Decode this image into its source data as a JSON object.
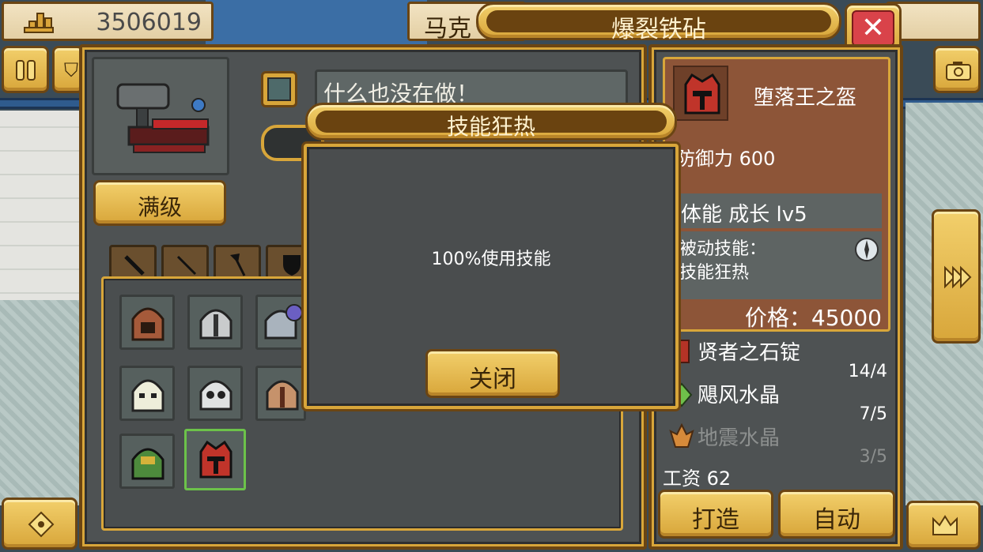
{
  "top": {
    "gold_amount": "3506019",
    "npc_name": "马克",
    "title": "爆裂铁砧",
    "close_symbol": "✕"
  },
  "left_buttons": {
    "pause_icon": "pause-icon",
    "settings_icon": "shield-icon"
  },
  "anvil": {
    "status": "什么也没在做！",
    "level_button": "满级"
  },
  "tabs": [
    {
      "name": "sword-tab",
      "glyph": "⚔"
    },
    {
      "name": "staff-tab",
      "glyph": "／"
    },
    {
      "name": "axe-tab",
      "glyph": "🪓"
    },
    {
      "name": "shield-tab",
      "glyph": "⛊"
    }
  ],
  "helmets": [
    {
      "name": "leather-hood",
      "color": "#a55a3a"
    },
    {
      "name": "iron-helm",
      "color": "#c9cbcc"
    },
    {
      "name": "plumed-helm",
      "color": "#a9b3bd"
    },
    {
      "name": "white-mask",
      "color": "#eeeeda"
    },
    {
      "name": "skull-helm",
      "color": "#e0e2e2"
    },
    {
      "name": "bronze-helm",
      "color": "#c6926b"
    },
    {
      "name": "green-helm",
      "color": "#4d8a3c"
    },
    {
      "name": "fallen-king-helm",
      "color": "#c0342a"
    }
  ],
  "modal": {
    "title": "技能狂热",
    "body": "100%使用技能",
    "close_button": "关闭"
  },
  "item": {
    "name": "堕落王之盔",
    "defense_label": "防御力",
    "defense_value": "600",
    "growth": "体能  成长  lv5",
    "passive_label": "被动技能：",
    "passive_name": "技能狂热",
    "price": "价格：45000"
  },
  "materials": [
    {
      "name": "贤者之石锭",
      "count": "14/4",
      "dim": false
    },
    {
      "name": "飓风水晶",
      "count": "7/5",
      "dim": false
    },
    {
      "name": "地震水晶",
      "count": "3/5",
      "dim": true
    }
  ],
  "wage": "工资  62",
  "actions": {
    "craft": "打造",
    "auto": "自动"
  },
  "right_buttons": {
    "camera_icon": "camera-icon",
    "next_icon": "fast-forward-icon",
    "crown_icon": "crown-icon",
    "dpad_icon": "dpad-icon"
  }
}
